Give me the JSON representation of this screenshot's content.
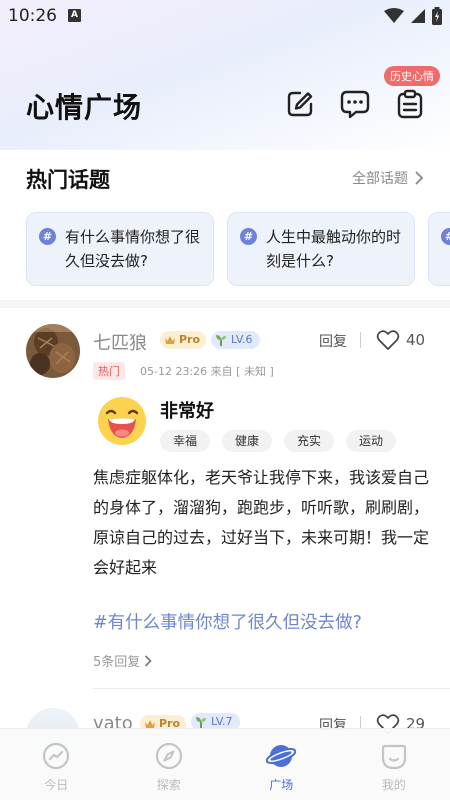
{
  "status_bar": {
    "time": "10:26",
    "notif_letter": "A"
  },
  "header": {
    "title": "心情广场",
    "history_badge": "历史心情"
  },
  "hot_topics": {
    "section_title": "热门话题",
    "all_link": "全部话题",
    "cards": [
      {
        "hash": "#",
        "text": "有什么事情你想了很久但没去做?"
      },
      {
        "hash": "#",
        "text": "人生中最触动你的时刻是什么?"
      }
    ]
  },
  "post": {
    "username": "七匹狼",
    "pro_label": "Pro",
    "level": "LV.6",
    "reply_label": "回复",
    "likes": "40",
    "hot_tag": "热门",
    "meta": "05-12 23:26  来自 [ 未知 ]",
    "mood": "非常好",
    "mood_tags": [
      "幸福",
      "健康",
      "充实",
      "运动"
    ],
    "body": "焦虑症躯体化，老天爷让我停下来，我该爱自己的身体了，溜溜狗，跑跑步，听听歌，刷刷剧，原谅自己的过去，过好当下，未来可期！我一定会好起来",
    "topic": "#有什么事情你想了很久但没去做?",
    "reply_count": "5条回复"
  },
  "post2": {
    "username": "vato",
    "pro_label": "Pro",
    "level": "LV.7",
    "reply_label": "回复",
    "likes": "29"
  },
  "nav": [
    {
      "label": "今日",
      "icon": "today-icon",
      "active": false
    },
    {
      "label": "探索",
      "icon": "compass-icon",
      "active": false
    },
    {
      "label": "广场",
      "icon": "planet-icon",
      "active": true
    },
    {
      "label": "我的",
      "icon": "profile-icon",
      "active": false
    }
  ],
  "colors": {
    "accent": "#4b6fd6",
    "topic_link": "#6f86cf",
    "badge_red": "#ee6b6b",
    "hot_red": "#e25c5c"
  }
}
